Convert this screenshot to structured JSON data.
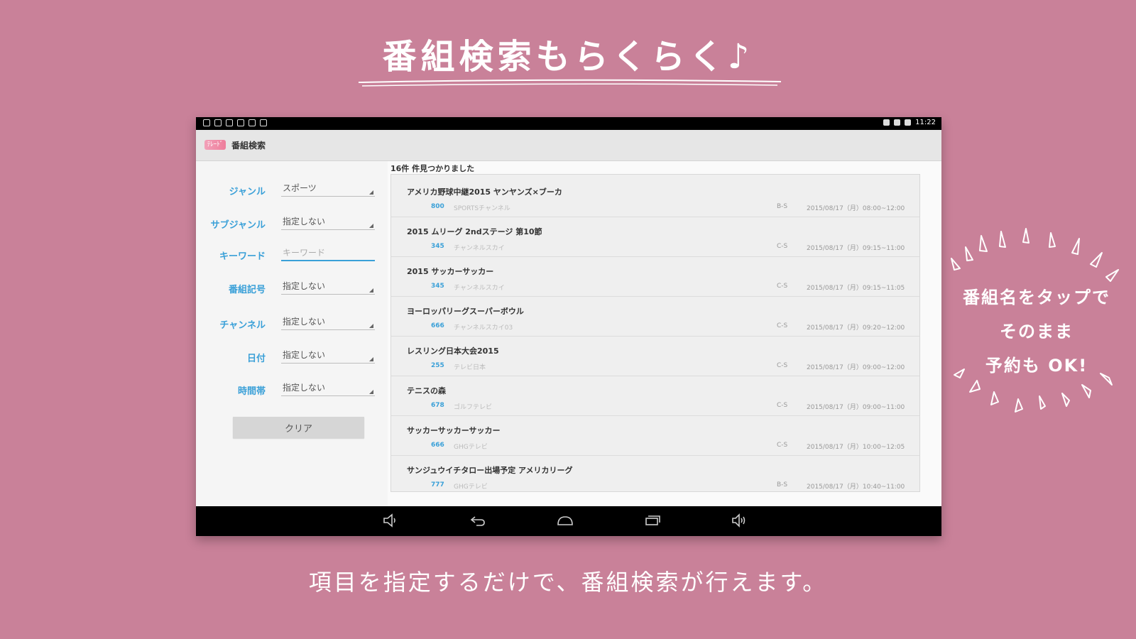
{
  "headline": "番組検索もらくらく♪",
  "footer_caption": "項目を指定するだけで、番組検索が行えます。",
  "side_callout": [
    "番組名をタップで",
    "そのまま",
    "予約も OK!"
  ],
  "colors": {
    "background": "#c98199",
    "accent": "#3aa0d8"
  },
  "app": {
    "statusbar_time": "11:22",
    "logo_text": "ﾃﾚｰﾄﾞ",
    "title": "番組検索",
    "form": [
      {
        "label": "ジャンル",
        "value": "スポーツ",
        "type": "select"
      },
      {
        "label": "サブジャンル",
        "value": "指定しない",
        "type": "select"
      },
      {
        "label": "キーワード",
        "value": "キーワード",
        "type": "input"
      },
      {
        "label": "番組記号",
        "value": "指定しない",
        "type": "select"
      },
      {
        "label": "チャンネル",
        "value": "指定しない",
        "type": "select"
      },
      {
        "label": "日付",
        "value": "指定しない",
        "type": "select"
      },
      {
        "label": "時間帯",
        "value": "指定しない",
        "type": "select"
      }
    ],
    "clear_label": "クリア",
    "results_count": "16件 件見つかりました",
    "results": [
      {
        "name": "アメリカ野球中継2015 ヤンヤンズ×ブーカ",
        "ch_num": "800",
        "ch_name": "SPORTSチャンネル",
        "band": "B-S",
        "datetime": "2015/08/17（月）08:00~12:00"
      },
      {
        "name": "2015 ムリーグ 2ndステージ 第10節",
        "ch_num": "345",
        "ch_name": "チャンネルスカイ",
        "band": "C-S",
        "datetime": "2015/08/17（月）09:15~11:00"
      },
      {
        "name": "2015 サッカーサッカー",
        "ch_num": "345",
        "ch_name": "チャンネルスカイ",
        "band": "C-S",
        "datetime": "2015/08/17（月）09:15~11:05"
      },
      {
        "name": "ヨーロッパリーグスーパーボウル",
        "ch_num": "666",
        "ch_name": "チャンネルスカイ03",
        "band": "C-S",
        "datetime": "2015/08/17（月）09:20~12:00"
      },
      {
        "name": "レスリング日本大会2015",
        "ch_num": "255",
        "ch_name": "テレビ日本",
        "band": "C-S",
        "datetime": "2015/08/17（月）09:00~12:00"
      },
      {
        "name": "テニスの森",
        "ch_num": "678",
        "ch_name": "ゴルフテレビ",
        "band": "C-S",
        "datetime": "2015/08/17（月）09:00~11:00"
      },
      {
        "name": "サッカーサッカーサッカー",
        "ch_num": "666",
        "ch_name": "GHGテレビ",
        "band": "C-S",
        "datetime": "2015/08/17（月）10:00~12:05"
      },
      {
        "name": "サンジュウイチタロー出場予定 アメリカリーグ",
        "ch_num": "777",
        "ch_name": "GHGテレビ",
        "band": "B-S",
        "datetime": "2015/08/17（月）10:40~11:00"
      }
    ],
    "nav_icons": [
      "volume-down-icon",
      "back-icon",
      "home-icon",
      "recent-apps-icon",
      "volume-up-icon"
    ]
  }
}
